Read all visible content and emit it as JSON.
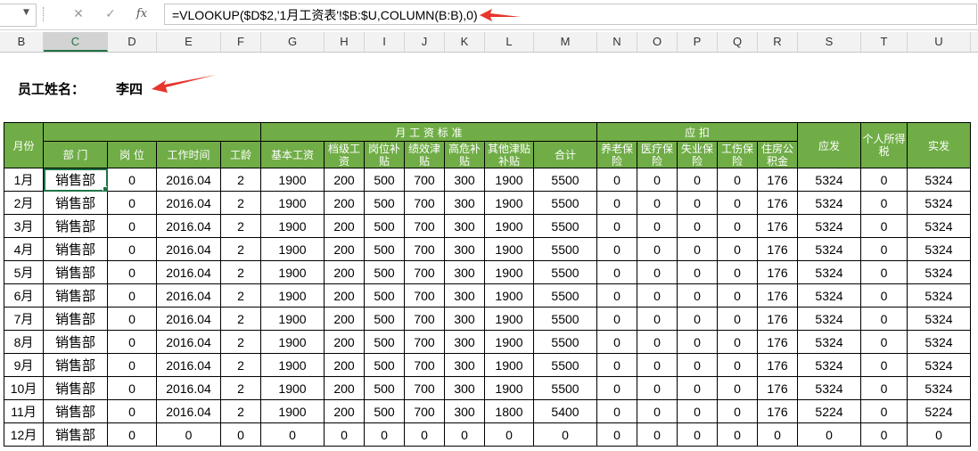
{
  "formula_bar": {
    "cancel_icon": "x-icon",
    "enter_icon": "check-icon",
    "fx_label": "fx",
    "formula": "=VLOOKUP($D$2,'1月工资表'!$B:$U,COLUMN(B:B),0)"
  },
  "columns": [
    "B",
    "C",
    "D",
    "E",
    "F",
    "G",
    "H",
    "I",
    "J",
    "K",
    "L",
    "M",
    "N",
    "O",
    "P",
    "Q",
    "R",
    "S",
    "T",
    "U"
  ],
  "selected_column": "C",
  "employee": {
    "label": "员工姓名：",
    "name": "李四"
  },
  "header_groups": {
    "month": "月份",
    "salary_standard": "月 工 资 标 准",
    "deduction": "应 扣",
    "gross": "应发",
    "tax": "个人所得税",
    "net": "实发"
  },
  "sub_headers": [
    "部 门",
    "岗 位",
    "工作时间",
    "工龄",
    "基本工资",
    "档级工资",
    "岗位补贴",
    "绩效津贴",
    "高危补贴",
    "其他津贴补贴",
    "合计",
    "养老保险",
    "医疗保险",
    "失业保险",
    "工伤保险",
    "住房公积金"
  ],
  "rows": [
    [
      "1月",
      "销售部",
      "0",
      "2016.04",
      "2",
      "1900",
      "200",
      "500",
      "700",
      "300",
      "1900",
      "5500",
      "0",
      "0",
      "0",
      "0",
      "176",
      "5324",
      "0",
      "5324"
    ],
    [
      "2月",
      "销售部",
      "0",
      "2016.04",
      "2",
      "1900",
      "200",
      "500",
      "700",
      "300",
      "1900",
      "5500",
      "0",
      "0",
      "0",
      "0",
      "176",
      "5324",
      "0",
      "5324"
    ],
    [
      "3月",
      "销售部",
      "0",
      "2016.04",
      "2",
      "1900",
      "200",
      "500",
      "700",
      "300",
      "1900",
      "5500",
      "0",
      "0",
      "0",
      "0",
      "176",
      "5324",
      "0",
      "5324"
    ],
    [
      "4月",
      "销售部",
      "0",
      "2016.04",
      "2",
      "1900",
      "200",
      "500",
      "700",
      "300",
      "1900",
      "5500",
      "0",
      "0",
      "0",
      "0",
      "176",
      "5324",
      "0",
      "5324"
    ],
    [
      "5月",
      "销售部",
      "0",
      "2016.04",
      "2",
      "1900",
      "200",
      "500",
      "700",
      "300",
      "1900",
      "5500",
      "0",
      "0",
      "0",
      "0",
      "176",
      "5324",
      "0",
      "5324"
    ],
    [
      "6月",
      "销售部",
      "0",
      "2016.04",
      "2",
      "1900",
      "200",
      "500",
      "700",
      "300",
      "1900",
      "5500",
      "0",
      "0",
      "0",
      "0",
      "176",
      "5324",
      "0",
      "5324"
    ],
    [
      "7月",
      "销售部",
      "0",
      "2016.04",
      "2",
      "1900",
      "200",
      "500",
      "700",
      "300",
      "1900",
      "5500",
      "0",
      "0",
      "0",
      "0",
      "176",
      "5324",
      "0",
      "5324"
    ],
    [
      "8月",
      "销售部",
      "0",
      "2016.04",
      "2",
      "1900",
      "200",
      "500",
      "700",
      "300",
      "1900",
      "5500",
      "0",
      "0",
      "0",
      "0",
      "176",
      "5324",
      "0",
      "5324"
    ],
    [
      "9月",
      "销售部",
      "0",
      "2016.04",
      "2",
      "1900",
      "200",
      "500",
      "700",
      "300",
      "1900",
      "5500",
      "0",
      "0",
      "0",
      "0",
      "176",
      "5324",
      "0",
      "5324"
    ],
    [
      "10月",
      "销售部",
      "0",
      "2016.04",
      "2",
      "1900",
      "200",
      "500",
      "700",
      "300",
      "1900",
      "5500",
      "0",
      "0",
      "0",
      "0",
      "176",
      "5324",
      "0",
      "5324"
    ],
    [
      "11月",
      "销售部",
      "0",
      "2016.04",
      "2",
      "1900",
      "200",
      "500",
      "700",
      "300",
      "1800",
      "5400",
      "0",
      "0",
      "0",
      "0",
      "176",
      "5224",
      "0",
      "5224"
    ],
    [
      "12月",
      "销售部",
      "0",
      "0",
      "0",
      "0",
      "0",
      "0",
      "0",
      "0",
      "0",
      "0",
      "0",
      "0",
      "0",
      "0",
      "0",
      "0",
      "0",
      "0"
    ]
  ],
  "colors": {
    "header_green": "#70ad47",
    "selection_green": "#217346",
    "arrow_red": "#e8352d"
  }
}
